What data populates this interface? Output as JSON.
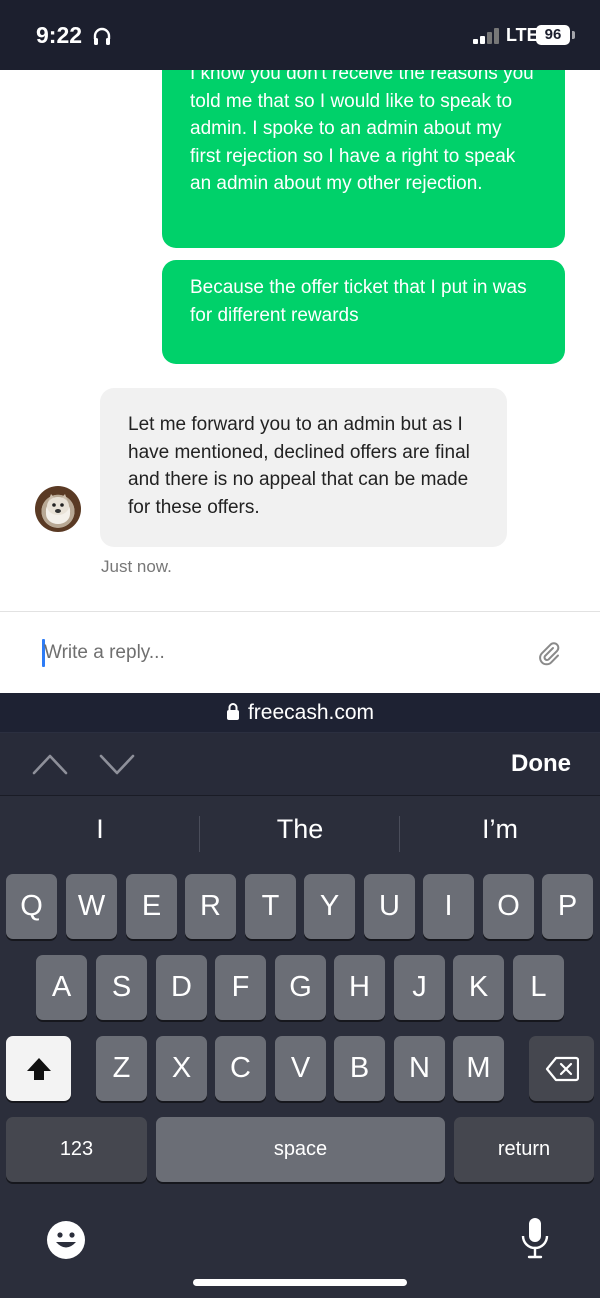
{
  "status_bar": {
    "time": "9:22",
    "network": "LTE",
    "battery": "96"
  },
  "messages": [
    {
      "direction": "outgoing",
      "text": "I know you don't receive the reasons you told me that so I would like to speak to admin. I spoke to an admin about my first rejection so I have a right to speak an admin about my other rejection."
    },
    {
      "direction": "outgoing",
      "text": "Because the offer ticket that I put in was for different rewards"
    },
    {
      "direction": "incoming",
      "text": "Let me forward you to an admin but as I have mentioned, declined offers are final and there is no appeal that can be made for these offers.",
      "timestamp": "Just now."
    }
  ],
  "reply": {
    "placeholder": "Write a reply...",
    "value": ""
  },
  "browser": {
    "url": "freecash.com"
  },
  "accessory": {
    "done_label": "Done"
  },
  "keyboard": {
    "suggestions": [
      "I",
      "The",
      "I’m"
    ],
    "row1": [
      "Q",
      "W",
      "E",
      "R",
      "T",
      "Y",
      "U",
      "I",
      "O",
      "P"
    ],
    "row2": [
      "A",
      "S",
      "D",
      "F",
      "G",
      "H",
      "J",
      "K",
      "L"
    ],
    "row3": [
      "Z",
      "X",
      "C",
      "V",
      "B",
      "N",
      "M"
    ],
    "numbers_label": "123",
    "space_label": "space",
    "return_label": "return"
  },
  "icons": [
    "headphones-icon",
    "signal-icon",
    "lock-icon",
    "paperclip-icon",
    "chevron-up-icon",
    "chevron-down-icon",
    "shift-icon",
    "backspace-icon",
    "emoji-icon",
    "microphone-icon"
  ]
}
